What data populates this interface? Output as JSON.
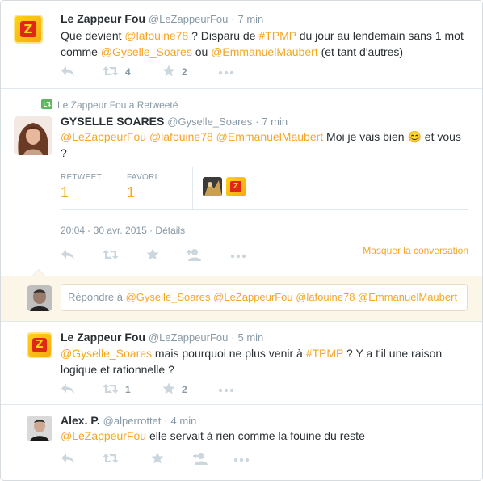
{
  "tweets": [
    {
      "name": "Le Zappeur Fou",
      "handle": "@LeZappeurFou",
      "dot": "·",
      "time": "7 min",
      "text": [
        {
          "t": "Que devient "
        },
        {
          "m": "@lafouine78"
        },
        {
          "t": " ? Disparu de "
        },
        {
          "h": "#TPMP"
        },
        {
          "t": " du jour au lendemain sans 1 mot comme "
        },
        {
          "m": "@Gyselle_Soares"
        },
        {
          "t": " ou "
        },
        {
          "m": "@EmmanuelMaubert"
        },
        {
          "t": " (et tant d'autres)"
        }
      ],
      "retweet_count": "4",
      "favorite_count": "2"
    },
    {
      "retweeted_by": "Le Zappeur Fou a Retweeté",
      "name": "GYSELLE SOARES",
      "handle": "@Gyselle_Soares",
      "dot": "·",
      "time": "7 min",
      "text": [
        {
          "m": "@LeZappeurFou"
        },
        {
          "t": " "
        },
        {
          "m": "@lafouine78"
        },
        {
          "t": " "
        },
        {
          "m": "@EmmanuelMaubert"
        },
        {
          "t": " Moi je vais bien "
        },
        {
          "e": "😊"
        },
        {
          "t": " et vous ?"
        }
      ],
      "stats": {
        "retweet_label": "RETWEET",
        "retweet_value": "1",
        "favori_label": "FAVORI",
        "favori_value": "1"
      },
      "datetime": "20:04 - 30 avr. 2015",
      "details": "· Détails",
      "hide_conversation": "Masquer la conversation"
    },
    {
      "name": "Le Zappeur Fou",
      "handle": "@LeZappeurFou",
      "dot": "·",
      "time": "5 min",
      "text": [
        {
          "m": "@Gyselle_Soares"
        },
        {
          "t": " mais pourquoi ne plus venir à "
        },
        {
          "h": "#TPMP"
        },
        {
          "t": " ? Y a t'il une raison logique et rationnelle ?"
        }
      ],
      "retweet_count": "1",
      "favorite_count": "2"
    },
    {
      "name": "Alex. P.",
      "handle": "@alperrottet",
      "dot": "·",
      "time": "4 min",
      "text": [
        {
          "m": "@LeZappeurFou"
        },
        {
          "t": " elle servait à rien comme la fouine du reste"
        }
      ]
    }
  ],
  "reply_box": {
    "prefix": "Répondre à ",
    "mentions": "@Gyselle_Soares @LeZappeurFou @lafouine78 @EmmanuelMaubert"
  },
  "avatar_glyph": "Z",
  "icons": {
    "reply": "reply-icon",
    "retweet": "retweet-icon",
    "favorite": "star-icon",
    "follow": "follow-icon",
    "more": "more-icon"
  },
  "colors": {
    "accent": "#f5a623",
    "muted": "#8899a6",
    "icon": "#ccd6dd",
    "reply_bg": "#fcf6e9"
  }
}
